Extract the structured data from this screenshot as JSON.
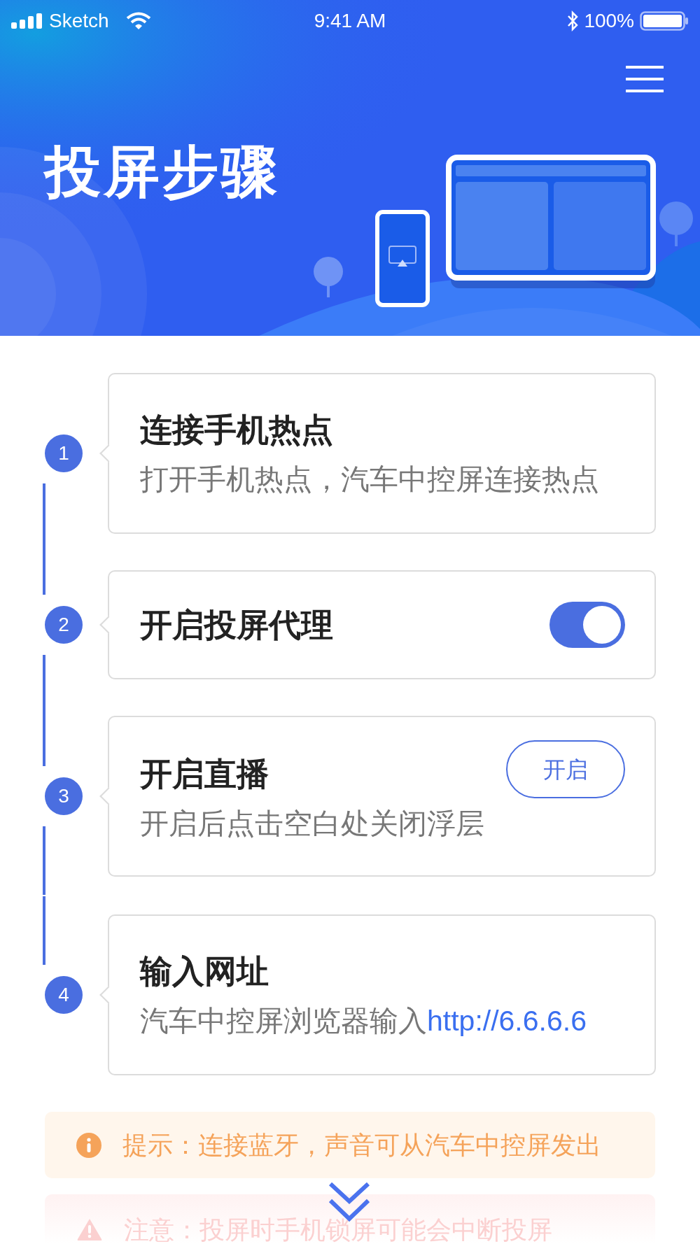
{
  "status_bar": {
    "carrier": "Sketch",
    "time": "9:41 AM",
    "battery": "100%"
  },
  "header": {
    "title": "投屏步骤"
  },
  "steps": [
    {
      "number": "1",
      "kind": "text",
      "title": "连接手机热点",
      "description": "打开手机热点，汽车中控屏连接热点"
    },
    {
      "number": "2",
      "kind": "toggle",
      "title": "开启投屏代理",
      "on": true
    },
    {
      "number": "3",
      "kind": "button",
      "title": "开启直播",
      "description": "开启后点击空白处关闭浮层",
      "button": "开启"
    },
    {
      "number": "4",
      "kind": "link",
      "title": "输入网址",
      "description": "汽车中控屏浏览器输入",
      "link": "http://6.6.6.6"
    }
  ],
  "notices": [
    {
      "kind": "info",
      "text": "提示：连接蓝牙，声音可从汽车中控屏发出"
    },
    {
      "kind": "warning",
      "text": "注意：投屏时手机锁屏可能会中断投屏"
    }
  ]
}
